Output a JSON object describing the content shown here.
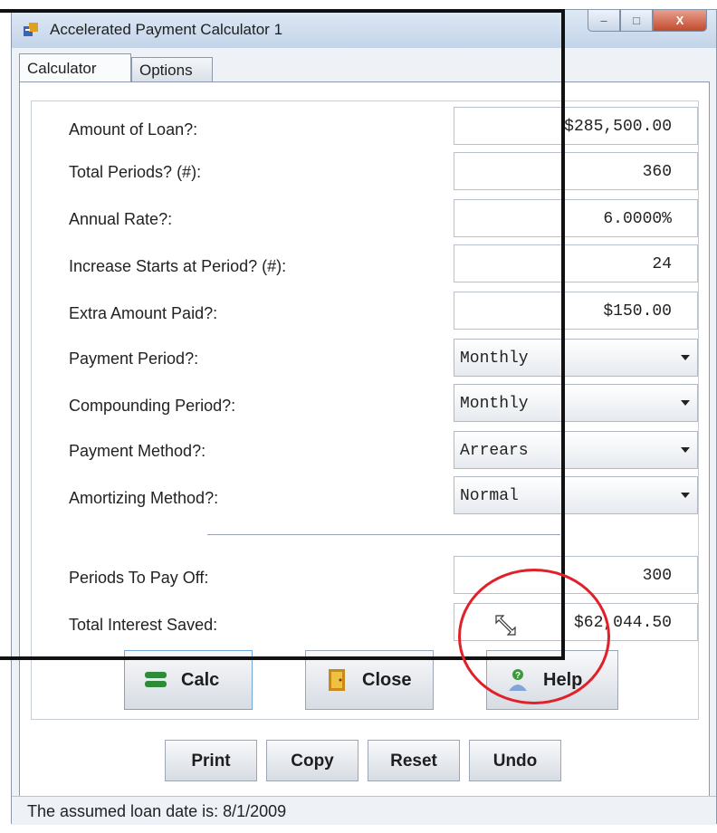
{
  "window": {
    "title": "Accelerated Payment  Calculator 1",
    "controls": {
      "minimize": "–",
      "maximize": "□",
      "close": "X"
    }
  },
  "tabs": [
    {
      "label": "Calculator",
      "active": true
    },
    {
      "label": "Options",
      "active": false
    }
  ],
  "fields": {
    "amount_of_loan": {
      "label": "Amount of Loan?:",
      "value": "$285,500.00"
    },
    "total_periods": {
      "label": "Total Periods? (#):",
      "value": "360"
    },
    "annual_rate": {
      "label": "Annual Rate?:",
      "value": "6.0000%"
    },
    "increase_start": {
      "label": "Increase Starts at Period? (#):",
      "value": "24"
    },
    "extra_amount": {
      "label": "Extra Amount Paid?:",
      "value": "$150.00"
    },
    "payment_period": {
      "label": "Payment Period?:",
      "value": "Monthly"
    },
    "compounding_period": {
      "label": "Compounding Period?:",
      "value": "Monthly"
    },
    "payment_method": {
      "label": "Payment Method?:",
      "value": "Arrears"
    },
    "amortizing_method": {
      "label": "Amortizing Method?:",
      "value": "Normal"
    }
  },
  "results": {
    "periods_to_pay_off": {
      "label": "Periods To Pay Off:",
      "value": "300"
    },
    "total_interest_saved": {
      "label": "Total Interest Saved:",
      "value": "$62,044.50"
    }
  },
  "buttons": {
    "calc": "Calc",
    "close": "Close",
    "help": "Help",
    "print": "Print",
    "copy": "Copy",
    "reset": "Reset",
    "undo": "Undo"
  },
  "status": {
    "text": "The assumed loan date is: 8/1/2009"
  },
  "colors": {
    "annotation_circle": "#e0212a",
    "annotation_rect": "#111111",
    "titlebar": "#c3d4e8"
  }
}
